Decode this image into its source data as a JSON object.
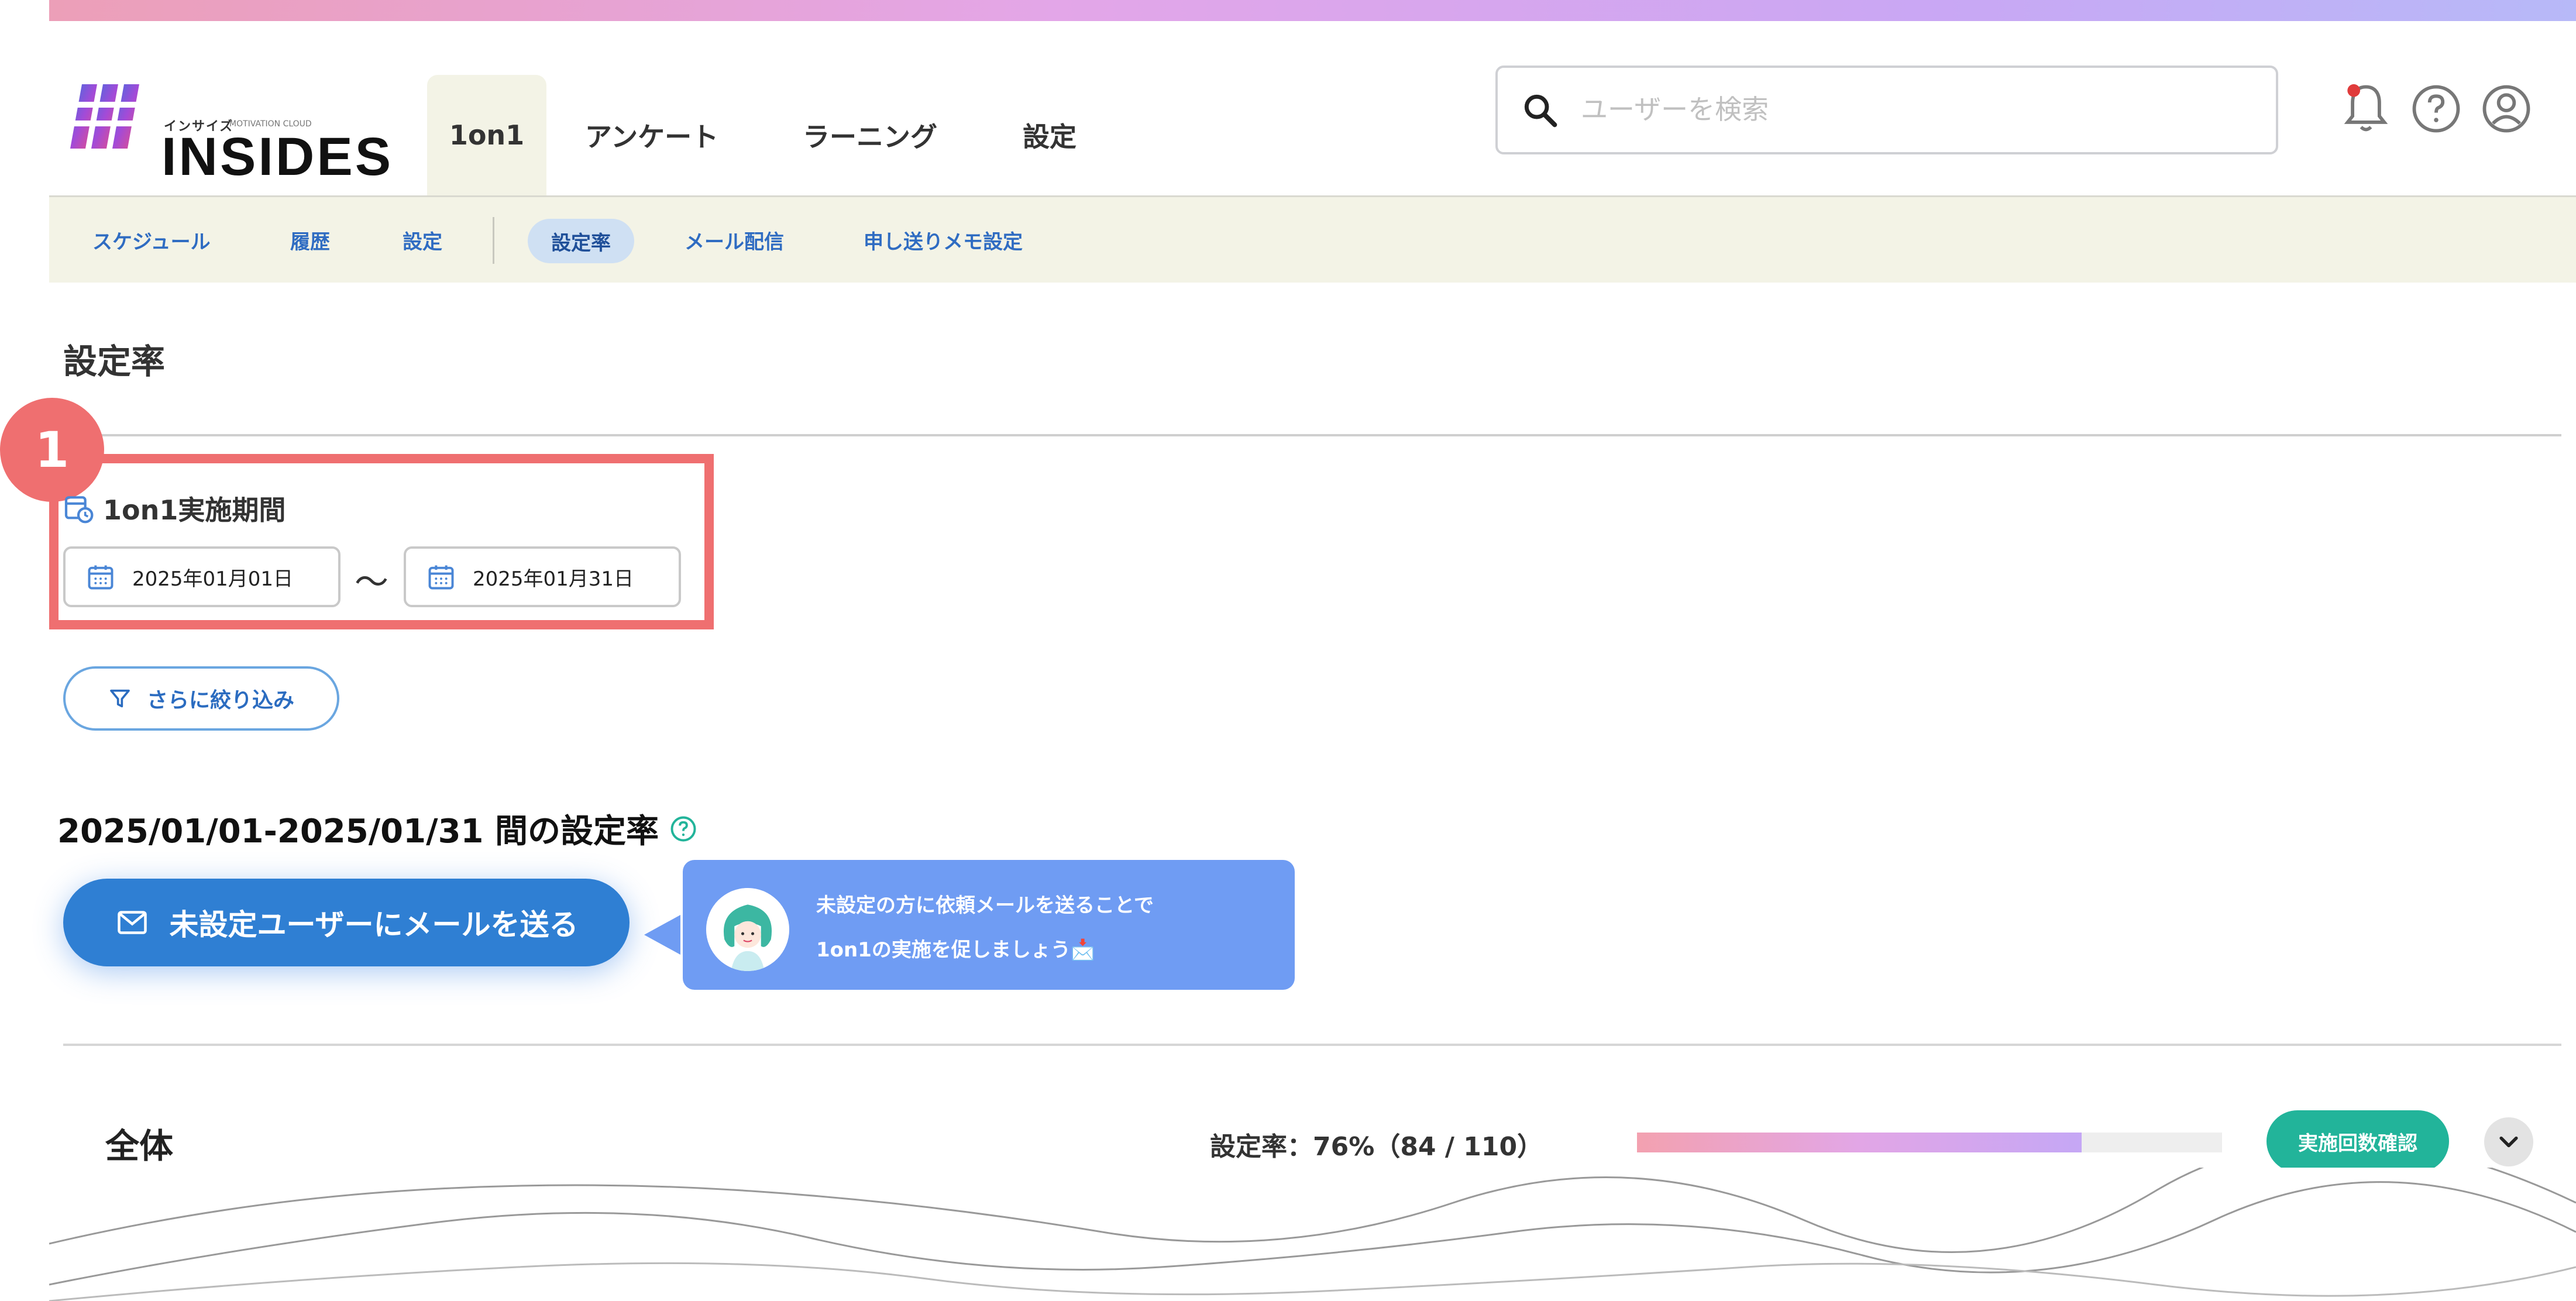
{
  "header": {
    "logo": {
      "kana": "インサイズ",
      "tagline": "MOTIVATION CLOUD",
      "wordmark": "INSIDES"
    },
    "tabs": [
      {
        "label": "1on1",
        "active": true
      },
      {
        "label": "アンケート",
        "active": false
      },
      {
        "label": "ラーニング",
        "active": false
      },
      {
        "label": "設定",
        "active": false
      }
    ],
    "search": {
      "placeholder": "ユーザーを検索",
      "value": ""
    },
    "icons": [
      "bell-icon",
      "help-icon",
      "account-icon"
    ],
    "notification_dot": true
  },
  "subnav": {
    "items": [
      {
        "label": "スケジュール",
        "active": false
      },
      {
        "label": "履歴",
        "active": false
      },
      {
        "label": "設定",
        "active": false
      },
      {
        "label": "設定率",
        "active": true
      },
      {
        "label": "メール配信",
        "active": false
      },
      {
        "label": "申し送りメモ設定",
        "active": false
      }
    ]
  },
  "page": {
    "title": "設定率",
    "annotation_badge": "1",
    "period": {
      "label": "1on1実施期間",
      "start": "2025年01月01日",
      "separator": "〜",
      "end": "2025年01月31日"
    },
    "filter_button": "さらに絞り込み",
    "rate_heading": "2025/01/01-2025/01/31 間の設定率",
    "mail_button": "未設定ユーザーにメールを送る",
    "bubble": {
      "line1": "未設定の方に依頼メールを送ることで",
      "line2": "1on1の実施を促しましょう📩"
    },
    "summary": {
      "label": "全体",
      "rate_text": "設定率：76%（84 / 110）",
      "progress": 0.76,
      "count_button": "実施回数確認"
    }
  },
  "colors": {
    "accent_blue": "#2f7fd3",
    "highlight_red": "#ef6f70",
    "teal": "#22b49a",
    "subnav_bg": "#f3f3e6"
  }
}
